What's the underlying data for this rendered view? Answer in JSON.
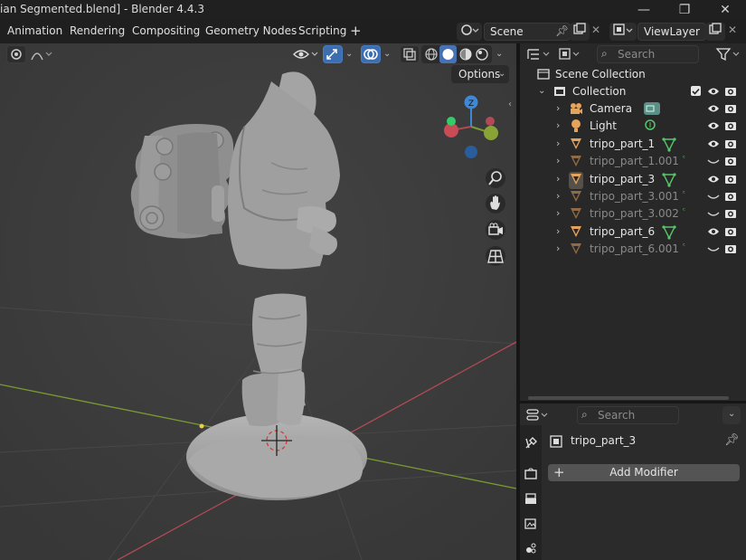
{
  "window": {
    "title": "ian Segmented.blend] - Blender 4.4.3",
    "minimize_glyph": "—",
    "maximize_glyph": "❐",
    "close_glyph": "✕"
  },
  "menus": [
    {
      "label": "Animation"
    },
    {
      "label": "Rendering"
    },
    {
      "label": "Compositing"
    },
    {
      "label": "Geometry Nodes"
    },
    {
      "label": "Scripting"
    }
  ],
  "add_workspace": "+",
  "scene": {
    "value": "Scene"
  },
  "view_layer": {
    "value": "ViewLayer"
  },
  "viewport": {
    "options_label": "Options",
    "gizmo_axes": {
      "x": "X",
      "y": "Y",
      "z": "Z"
    },
    "colors": {
      "x_axis": "#b04a55",
      "y_axis": "#7a9b32",
      "z_axis": "#3f88d6",
      "background": "#3d3d3d",
      "model": "#9d9d9d"
    }
  },
  "outliner": {
    "search_placeholder": "Search",
    "scene_collection": "Scene Collection",
    "collection": "Collection",
    "items": [
      {
        "label": "Camera",
        "icon": "camera-icon",
        "dim": false,
        "visible": true
      },
      {
        "label": "Light",
        "icon": "light-icon",
        "dim": false,
        "visible": true
      },
      {
        "label": "tripo_part_1",
        "icon": "mesh-icon",
        "dim": false,
        "visible": true
      },
      {
        "label": "tripo_part_1.001",
        "icon": "mesh-icon",
        "dim": true,
        "visible": false
      },
      {
        "label": "tripo_part_3",
        "icon": "mesh-icon",
        "dim": false,
        "visible": true
      },
      {
        "label": "tripo_part_3.001",
        "icon": "mesh-icon",
        "dim": true,
        "visible": false
      },
      {
        "label": "tripo_part_3.002",
        "icon": "mesh-icon",
        "dim": true,
        "visible": false
      },
      {
        "label": "tripo_part_6",
        "icon": "mesh-icon",
        "dim": false,
        "visible": true
      },
      {
        "label": "tripo_part_6.001",
        "icon": "mesh-icon",
        "dim": true,
        "visible": false
      }
    ]
  },
  "properties": {
    "search_placeholder": "Search",
    "object_name": "tripo_part_3",
    "add_modifier": "Add Modifier",
    "add_modifier_plus": "+"
  }
}
